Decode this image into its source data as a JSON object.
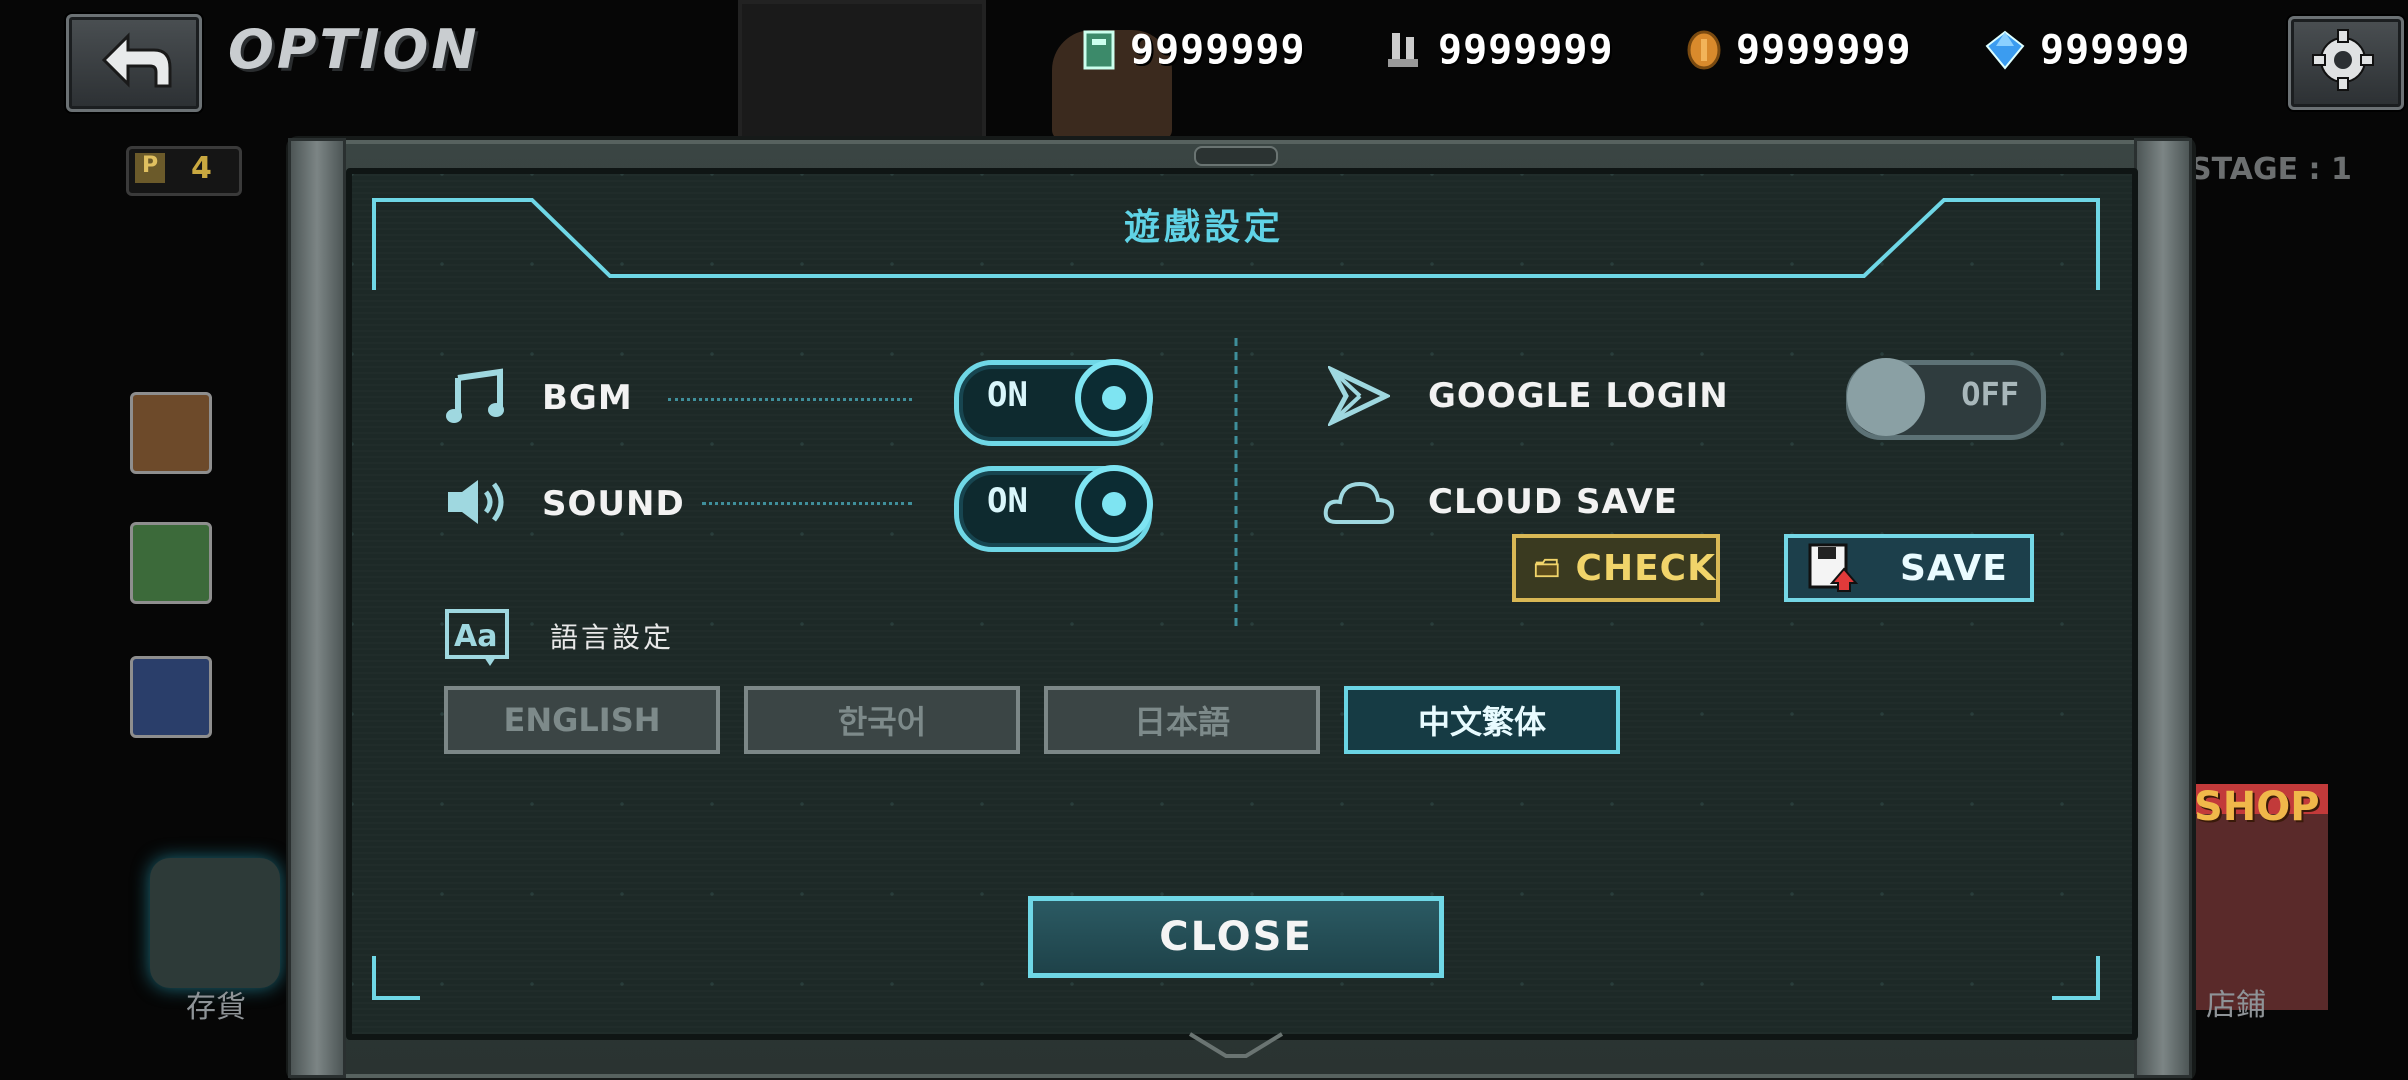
{
  "header": {
    "title": "OPTION",
    "back_icon": "back-arrow-icon",
    "settings_icon": "gear-icon"
  },
  "resources": [
    {
      "icon": "ticket-icon",
      "value": "9999999"
    },
    {
      "icon": "parts-icon",
      "value": "9999999"
    },
    {
      "icon": "coin-icon",
      "value": "9999999"
    },
    {
      "icon": "gem-icon",
      "value": "999999"
    }
  ],
  "side": {
    "points_label": "P",
    "points_value": "4",
    "stage_text": "STAGE : 1",
    "inventory_label": "存貨",
    "shop_sign": "SHOP",
    "shop_label": "店鋪"
  },
  "panel": {
    "title": "遊戲設定",
    "bgm_label": "BGM",
    "bgm_state": "ON",
    "sound_label": "SOUND",
    "sound_state": "ON",
    "google_label": "GOOGLE LOGIN",
    "google_state": "OFF",
    "cloud_label": "CLOUD SAVE",
    "check_label": "CHECK",
    "save_label": "SAVE",
    "language_label": "語言設定",
    "languages": [
      "ENGLISH",
      "한국어",
      "日本語",
      "中文繁体"
    ],
    "active_language": "中文繁体",
    "close_label": "CLOSE"
  },
  "colors": {
    "accent": "#6fd7e6",
    "check_gold": "#d9b855",
    "panel_bg": "#1d2927"
  }
}
